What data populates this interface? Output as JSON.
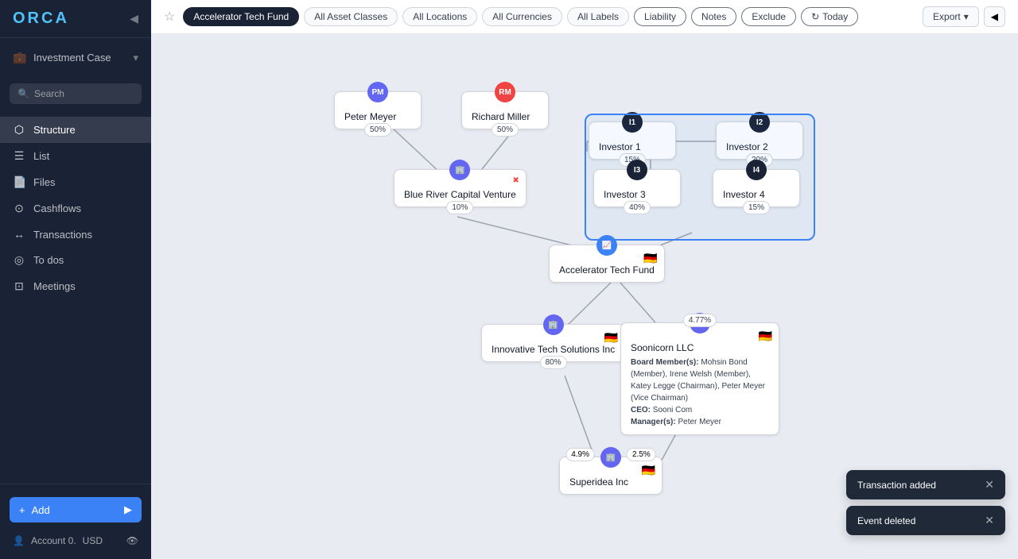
{
  "app": {
    "logo": "ORCA",
    "collapse_icon": "◀"
  },
  "sidebar": {
    "investment_case_label": "Investment Case",
    "search_placeholder": "Search",
    "nav_items": [
      {
        "id": "structure",
        "label": "Structure",
        "icon": "⬡",
        "active": true
      },
      {
        "id": "list",
        "label": "List",
        "icon": "☰",
        "active": false
      },
      {
        "id": "files",
        "label": "Files",
        "icon": "📄",
        "active": false
      },
      {
        "id": "cashflows",
        "label": "Cashflows",
        "icon": "⊙",
        "active": false
      },
      {
        "id": "transactions",
        "label": "Transactions",
        "icon": "↔",
        "active": false
      },
      {
        "id": "todos",
        "label": "To dos",
        "icon": "◎",
        "active": false
      },
      {
        "id": "meetings",
        "label": "Meetings",
        "icon": "⊡",
        "active": false
      }
    ],
    "add_button_label": "Add",
    "account_label": "Account 0.",
    "currency": "USD"
  },
  "toolbar": {
    "fund_filter": "Accelerator Tech Fund",
    "asset_classes_filter": "All Asset Classes",
    "locations_filter": "All Locations",
    "currencies_filter": "All Currencies",
    "labels_filter": "All Labels",
    "liability_label": "Liability",
    "notes_label": "Notes",
    "exclude_label": "Exclude",
    "today_label": "Today",
    "export_label": "Export"
  },
  "nodes": {
    "peter_meyer": {
      "initials": "PM",
      "name": "Peter Meyer",
      "percent": "50%"
    },
    "richard_miller": {
      "initials": "RM",
      "name": "Richard Miller",
      "percent": "50%"
    },
    "investor1": {
      "initials": "I1",
      "label": "Investor 1",
      "percent": "15%"
    },
    "investor2": {
      "initials": "I2",
      "label": "Investor 2",
      "percent": "20%"
    },
    "investor3": {
      "initials": "I3",
      "label": "Investor 3",
      "percent": "40%"
    },
    "investor4": {
      "initials": "I4",
      "label": "Investor 4",
      "percent": "15%"
    },
    "blue_river": {
      "label": "Blue River Capital Venture",
      "percent": "10%"
    },
    "accelerator": {
      "initials": "~",
      "label": "Accelerator Tech Fund"
    },
    "innovative": {
      "label": "Innovative Tech Solutions Inc",
      "percent": "80%"
    },
    "soonicorn": {
      "label": "Soonicorn LLC",
      "percent": "4.77%",
      "board_members": "Mohsin Bond (Member), Irene Welsh (Member), Katey Legge (Chairman), Peter Meyer (Vice Chairman)",
      "ceo": "Sooni Com",
      "manager": "Peter Meyer"
    },
    "superidea": {
      "label": "Superidea Inc",
      "percent1": "4.9%",
      "percent2": "2.5%"
    }
  },
  "toasts": [
    {
      "id": "t1",
      "message": "Transaction added"
    },
    {
      "id": "t2",
      "message": "Event deleted"
    }
  ],
  "labels": {
    "board_members": "Board Member(s):",
    "ceo": "CEO:",
    "manager": "Manager(s):"
  }
}
